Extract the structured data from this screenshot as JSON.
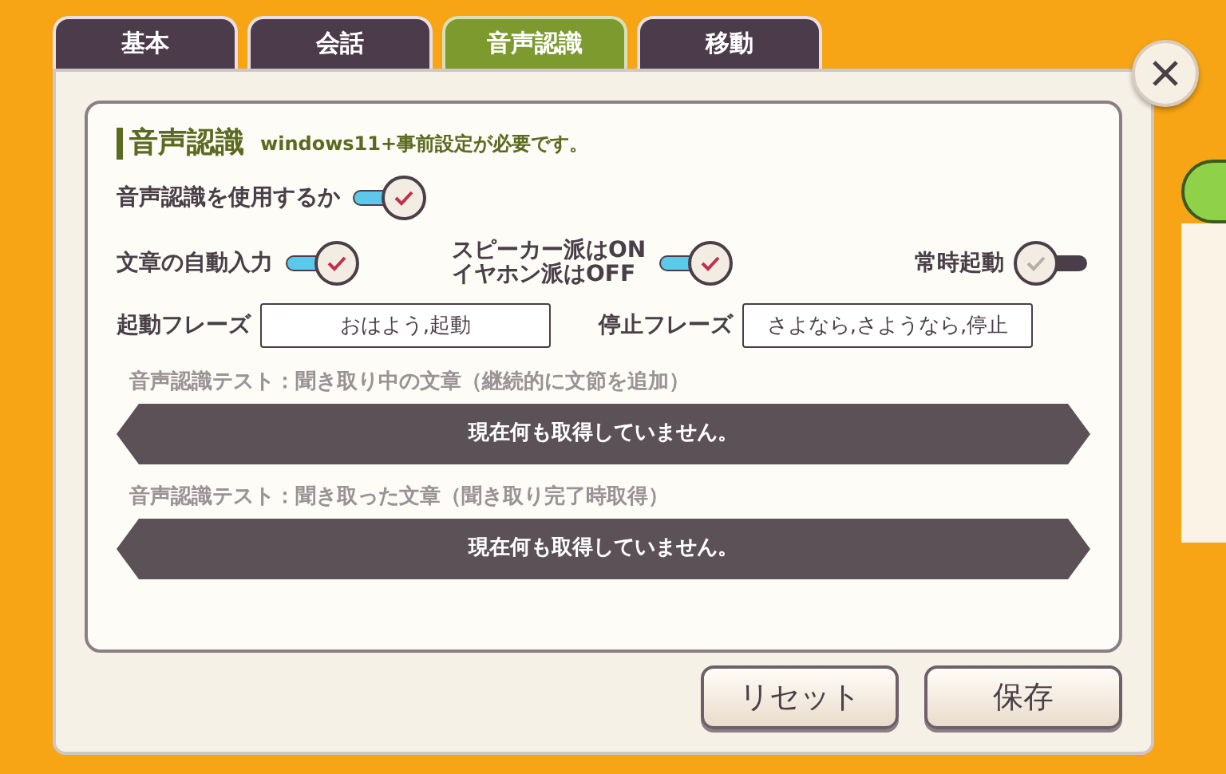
{
  "tabs": [
    {
      "label": "基本",
      "selected": false
    },
    {
      "label": "会話",
      "selected": false
    },
    {
      "label": "音声認識",
      "selected": true
    },
    {
      "label": "移動",
      "selected": false
    }
  ],
  "section": {
    "title": "音声認識",
    "note": "windows11+事前設定が必要です。"
  },
  "main_toggle": {
    "label": "音声認識を使用するか",
    "on": true
  },
  "toggles": [
    {
      "label": "文章の自動入力",
      "on": true
    },
    {
      "label": "スピーカー派はON\nイヤホン派はOFF",
      "on": true
    },
    {
      "label": "常時起動",
      "on": false
    }
  ],
  "phrases": [
    {
      "label": "起動フレーズ",
      "value": "おはよう,起動"
    },
    {
      "label": "停止フレーズ",
      "value": "さよなら,さようなら,停止"
    }
  ],
  "tests": [
    {
      "label": "音声認識テスト：聞き取り中の文章（継続的に文節を追加）",
      "value": "現在何も取得していません。"
    },
    {
      "label": "音声認識テスト：聞き取った文章（聞き取り完了時取得）",
      "value": "現在何も取得していません。"
    }
  ],
  "buttons": [
    "リセット",
    "保存"
  ]
}
